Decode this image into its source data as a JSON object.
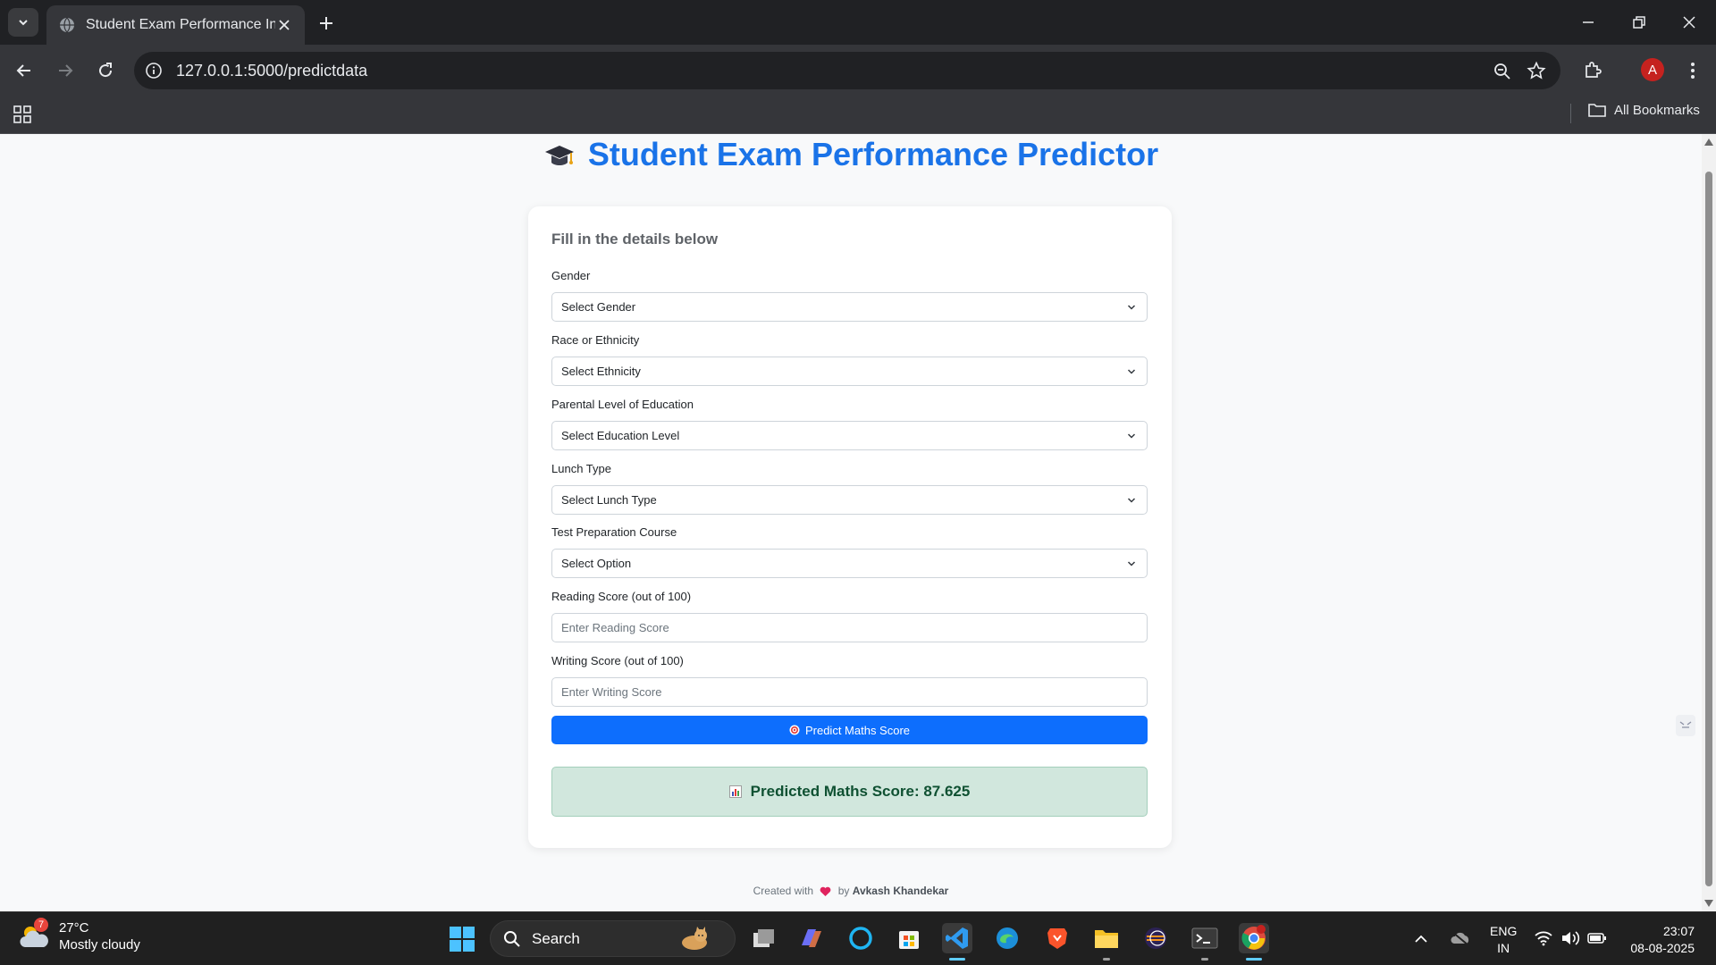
{
  "browser": {
    "tab_title": "Student Exam Performance Indi",
    "url": "127.0.0.1:5000/predictdata",
    "profile_initial": "A",
    "bookmarks_label": "All Bookmarks"
  },
  "page": {
    "title": "Student Exam Performance Predictor",
    "form_heading": "Fill in the details below",
    "fields": [
      {
        "label": "Gender",
        "value": "Select Gender",
        "type": "select"
      },
      {
        "label": "Race or Ethnicity",
        "value": "Select Ethnicity",
        "type": "select"
      },
      {
        "label": "Parental Level of Education",
        "value": "Select Education Level",
        "type": "select"
      },
      {
        "label": "Lunch Type",
        "value": "Select Lunch Type",
        "type": "select"
      },
      {
        "label": "Test Preparation Course",
        "value": "Select Option",
        "type": "select"
      },
      {
        "label": "Reading Score (out of 100)",
        "placeholder": "Enter Reading Score",
        "type": "input"
      },
      {
        "label": "Writing Score (out of 100)",
        "placeholder": "Enter Writing Score",
        "type": "input"
      }
    ],
    "submit_label": "Predict Maths Score",
    "result_label": "Predicted Maths Score: 87.625",
    "footer": {
      "prefix": "Created with",
      "by": "by",
      "author": "Avkash Khandekar"
    },
    "colors": {
      "title": "#1a73e8",
      "button": "#0d6efd",
      "result_bg": "#d1e7dd",
      "result_text": "#0f5132"
    }
  },
  "taskbar": {
    "weather_temp": "27°C",
    "weather_desc": "Mostly cloudy",
    "weather_badge": "7",
    "search_label": "Search",
    "lang_line1": "ENG",
    "lang_line2": "IN",
    "time": "23:07",
    "date": "08-08-2025"
  }
}
